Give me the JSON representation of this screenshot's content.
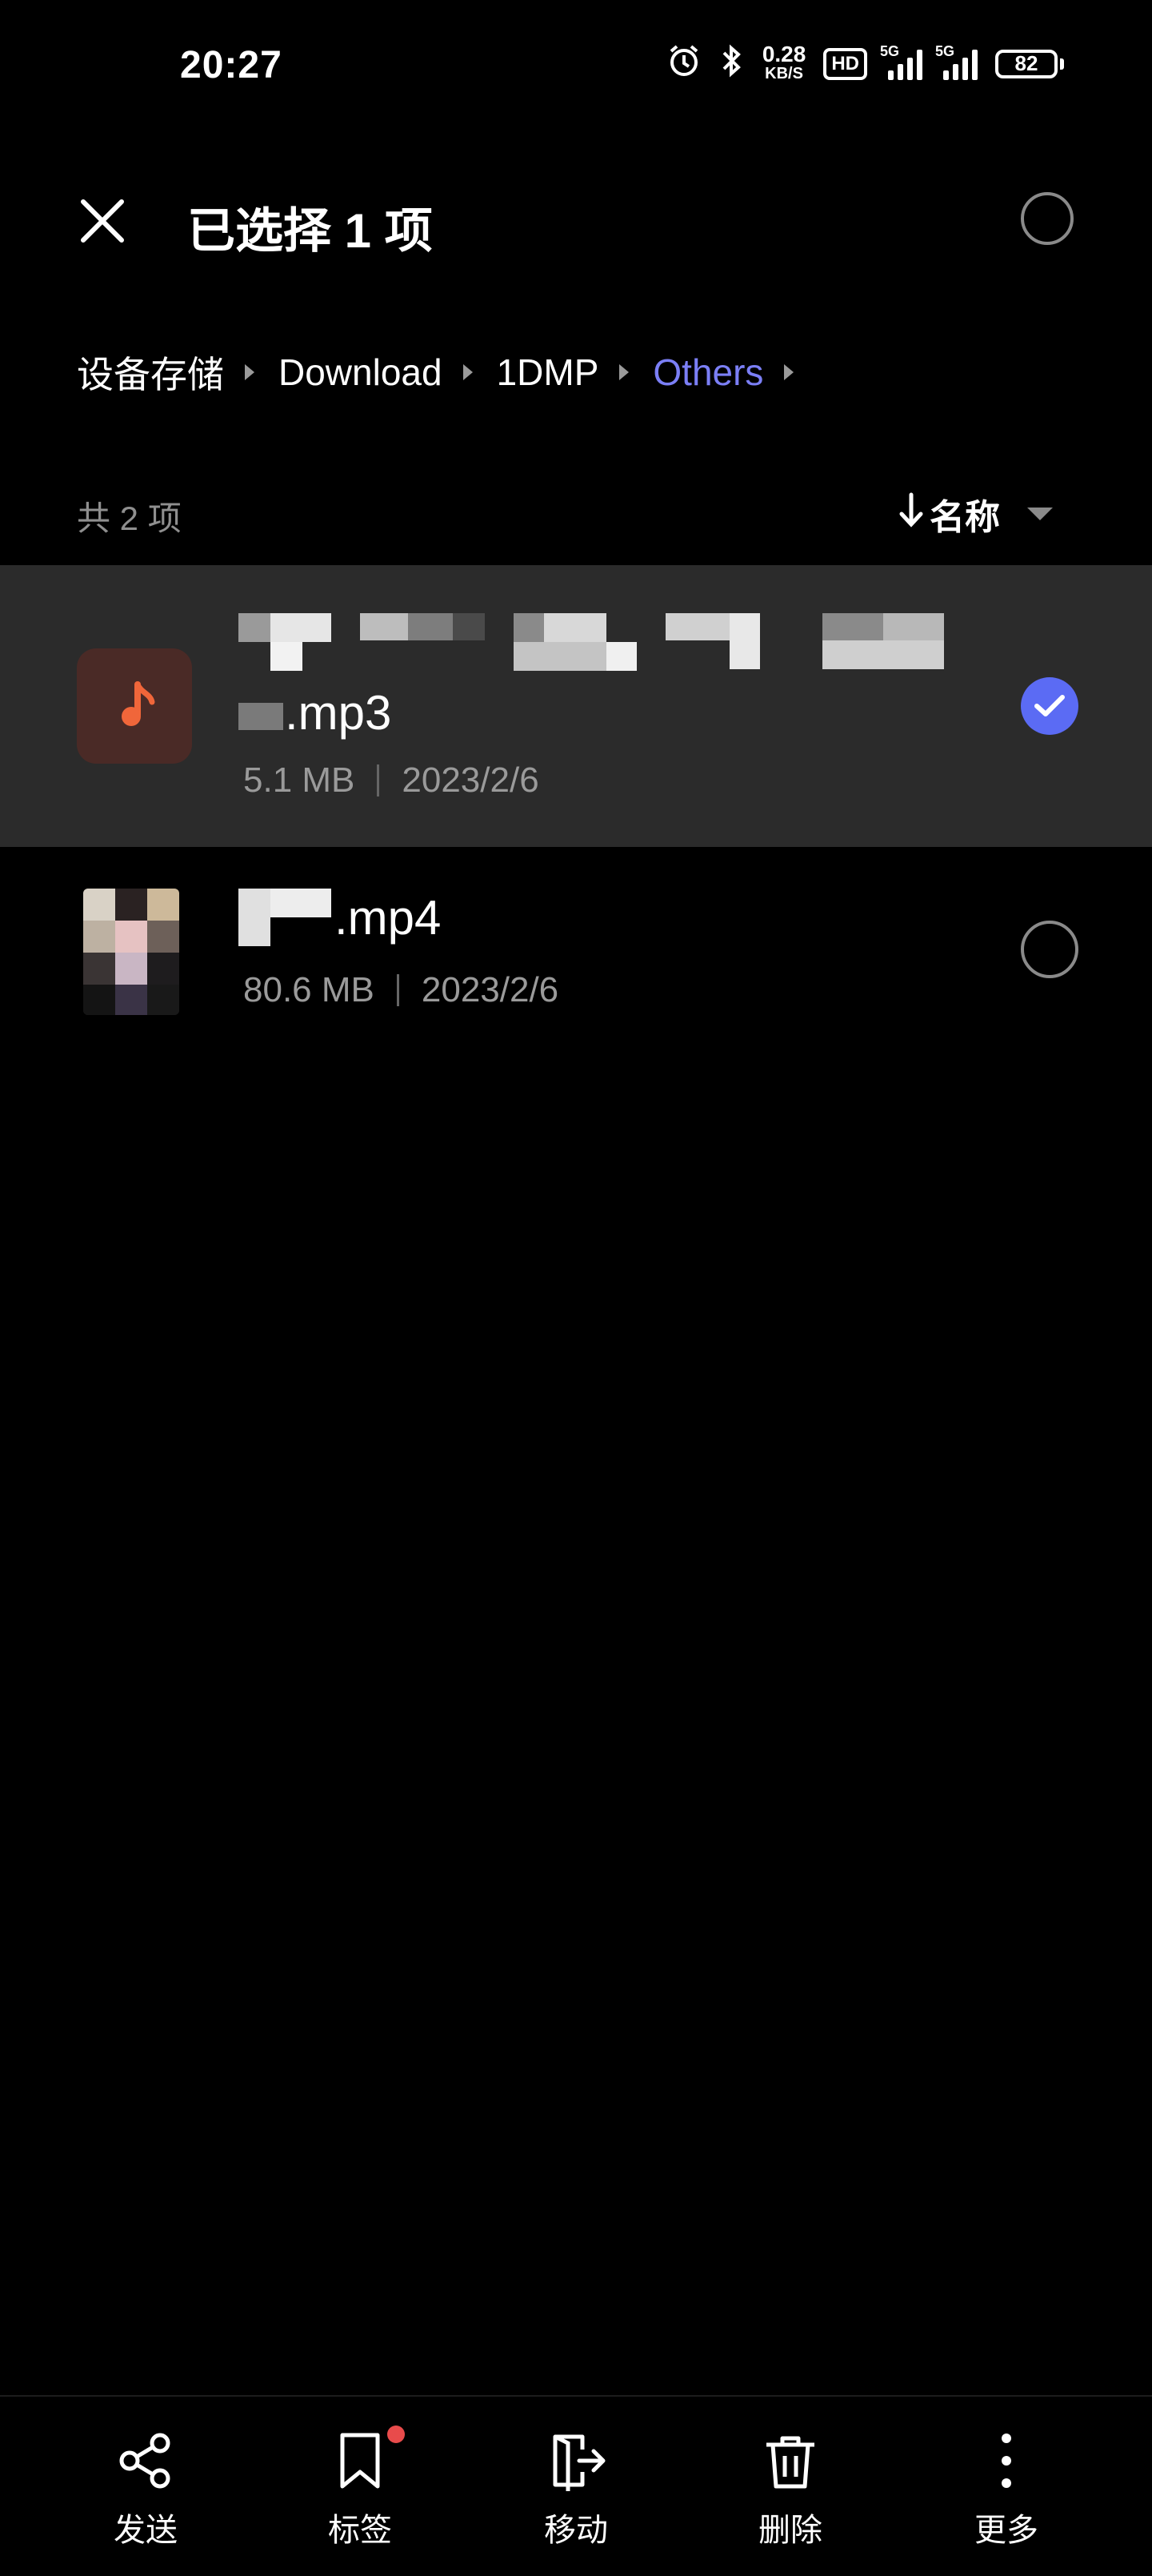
{
  "status": {
    "time": "20:27",
    "net_speed": "0.28",
    "net_unit": "KB/S",
    "hd_label": "HD",
    "sim1": "5G",
    "sim2": "5G",
    "battery": "82"
  },
  "header": {
    "title": "已选择 1 项"
  },
  "breadcrumb": [
    "设备存储",
    "Download",
    "1DMP",
    "Others"
  ],
  "list": {
    "count_label": "共 2 项",
    "sort_label": "名称",
    "items": [
      {
        "name_suffix": ".mp3",
        "size": "5.1 MB",
        "date": "2023/2/6",
        "selected": true
      },
      {
        "name_suffix": ".mp4",
        "size": "80.6 MB",
        "date": "2023/2/6",
        "selected": false
      }
    ]
  },
  "toolbar": [
    {
      "label": "发送",
      "icon": "share-icon"
    },
    {
      "label": "标签",
      "icon": "bookmark-icon"
    },
    {
      "label": "移动",
      "icon": "move-icon"
    },
    {
      "label": "删除",
      "icon": "trash-icon"
    },
    {
      "label": "更多",
      "icon": "more-vertical-icon"
    }
  ],
  "colors": {
    "accent": "#7b7ff6",
    "check": "#5b6bf4",
    "selected_row": "#2b2b2b",
    "audio_icon": "#f0663a",
    "badge": "#e84b4b"
  }
}
